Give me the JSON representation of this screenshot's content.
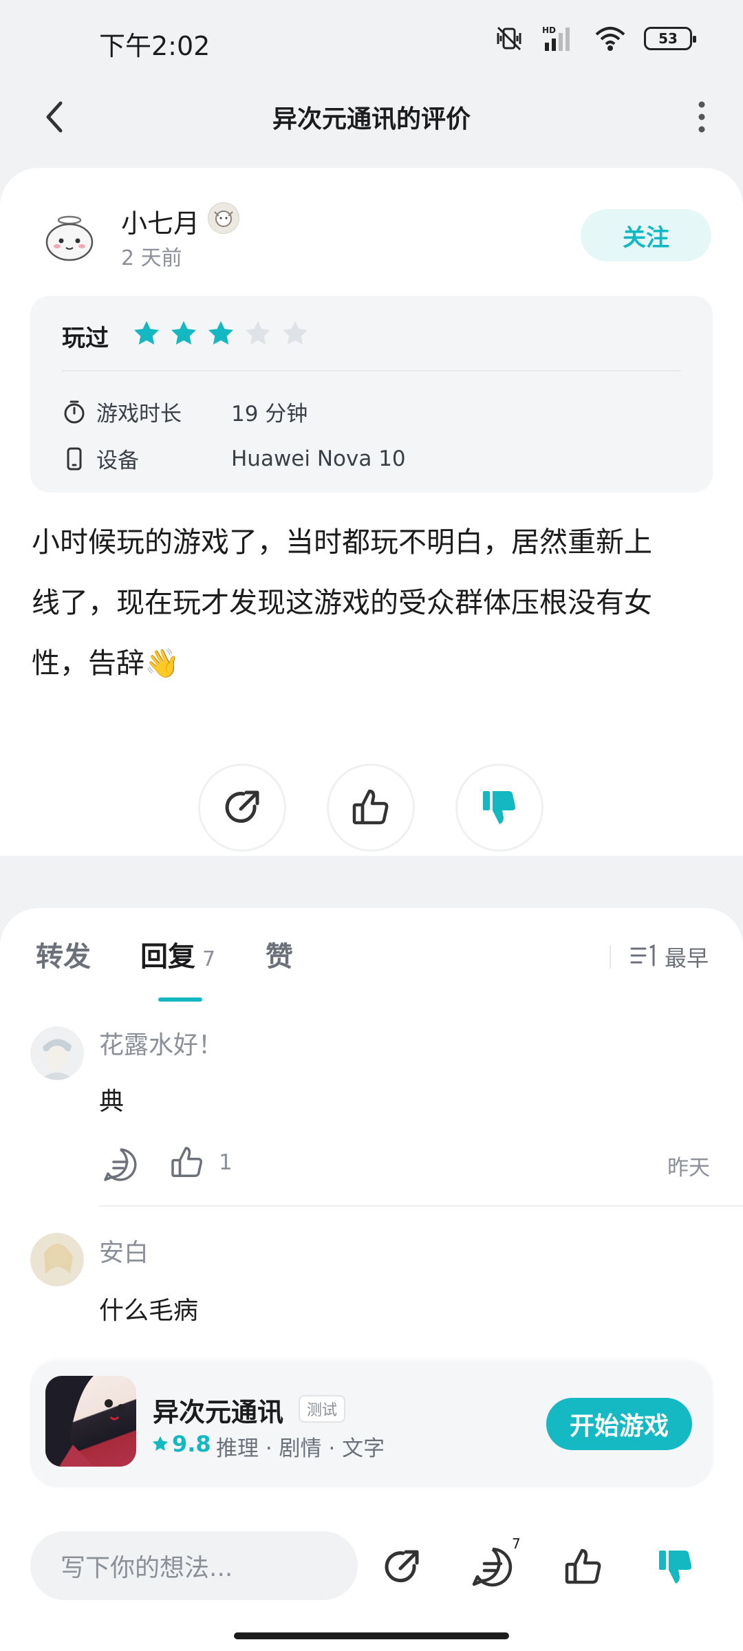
{
  "status_bar": {
    "time": "下午2:02",
    "battery": "53",
    "network_label": "HD"
  },
  "header": {
    "title": "异次元通讯的评价"
  },
  "review": {
    "username": "小七月",
    "time_ago": "2 天前",
    "follow_label": "关注",
    "played_label": "玩过",
    "rating": 3,
    "rating_max": 5,
    "playtime_label": "游戏时长",
    "playtime_value": "19 分钟",
    "device_label": "设备",
    "device_value": "Huawei Nova 10",
    "text_line1": "小时候玩的游戏了，当时都玩不明白，居然重新上",
    "text_line2": "线了，现在玩才发现这游戏的受众群体压根没有女",
    "text_line3": "性，告辞👋"
  },
  "tabs": [
    {
      "label": "转发"
    },
    {
      "label": "回复",
      "count": "7"
    },
    {
      "label": "赞"
    }
  ],
  "sort_label": "最早",
  "comments": [
    {
      "name": "花露水好！",
      "text": "典",
      "likes": "1",
      "date": "昨天"
    },
    {
      "name": "安白",
      "text": "什么毛病"
    }
  ],
  "game": {
    "name": "异次元通讯",
    "tag": "测试",
    "rating": "9.8",
    "tags": "推理 · 剧情 · 文字",
    "start_label": "开始游戏"
  },
  "bottom": {
    "input_placeholder": "写下你的想法...",
    "comment_count": "7"
  },
  "colors": {
    "accent": "#13b8c2",
    "text": "#1c1c1e",
    "muted": "#8a8f98",
    "star_off": "#dfe2e6"
  }
}
